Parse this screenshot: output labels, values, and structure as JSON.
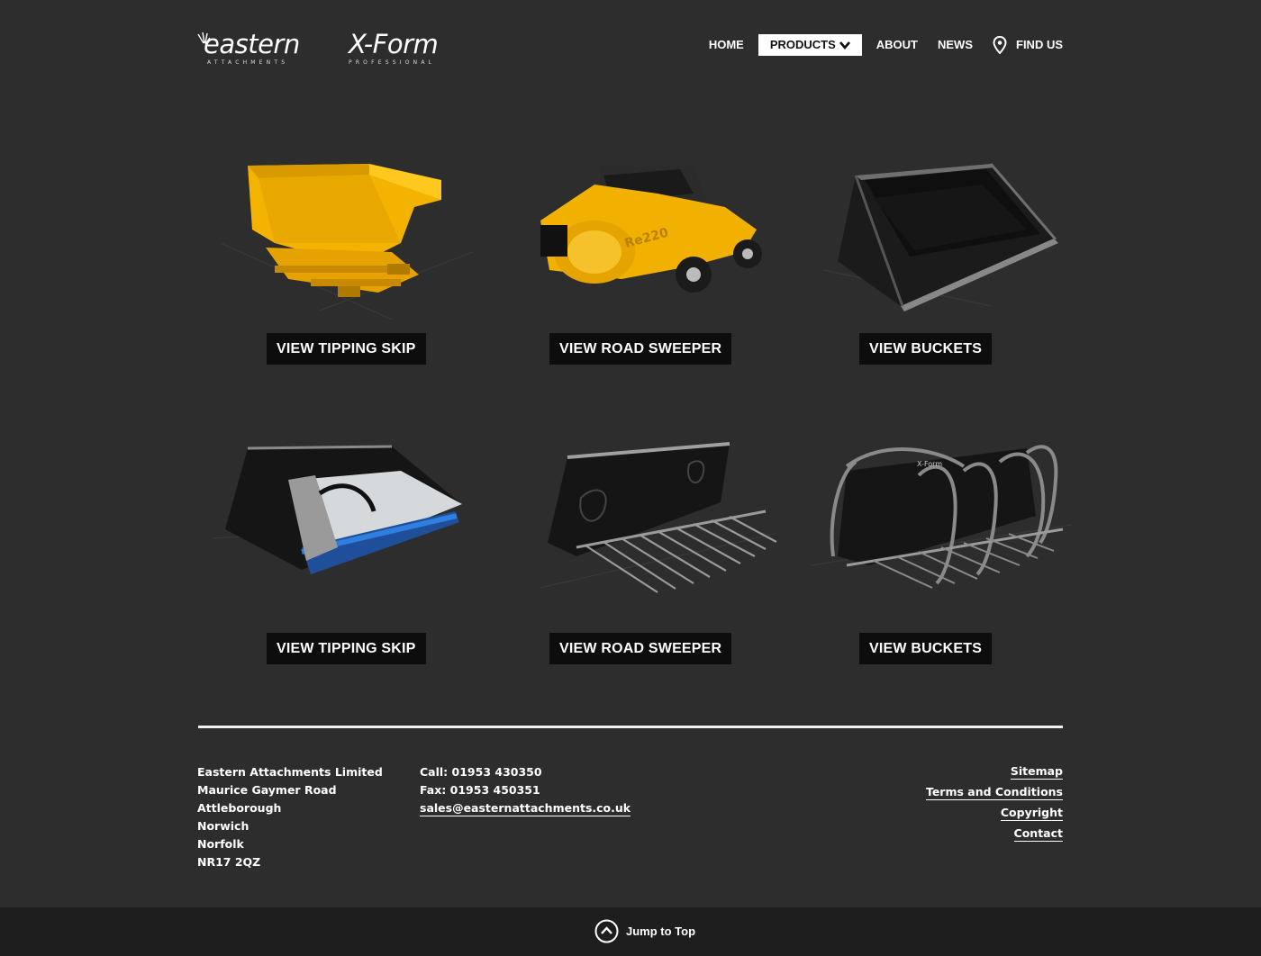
{
  "header": {
    "logo_eastern": "eastern",
    "logo_eastern_sub": "ATTACHMENTS",
    "logo_xform": "X-Form",
    "logo_xform_sub": "PROFESSIONAL",
    "nav": {
      "home": "HOME",
      "products": "PRODUCTS",
      "about": "ABOUT",
      "news": "NEWS",
      "find_us": "FIND US"
    }
  },
  "products": [
    {
      "label": "VIEW TIPPING SKIP",
      "image": "yellow tipping skip"
    },
    {
      "label": "VIEW ROAD SWEEPER",
      "image": "yellow road sweeper"
    },
    {
      "label": "VIEW BUCKETS",
      "image": "black bucket"
    },
    {
      "label": "VIEW TIPPING SKIP",
      "image": "sweeper bucket"
    },
    {
      "label": "VIEW ROAD SWEEPER",
      "image": "muck fork"
    },
    {
      "label": "VIEW BUCKETS",
      "image": "grab fork"
    }
  ],
  "footer": {
    "address": [
      "Eastern Attachments Limited",
      "Maurice Gaymer Road",
      "Attleborough",
      "Norwich",
      "Norfolk",
      "NR17 2QZ"
    ],
    "call": "Call: 01953 430350",
    "fax": "Fax: 01953 450351",
    "email": "sales@easternattachments.co.uk",
    "links": {
      "sitemap": "Sitemap",
      "terms": "Terms and Conditions",
      "copyright": "Copyright",
      "contact": "Contact"
    },
    "jump_to_top": "Jump to Top"
  },
  "colors": {
    "background": "#2d2d2d",
    "button": "#0d0d0d",
    "accent_yellow": "#f2b200",
    "bottom_bar": "#1e1e1e"
  }
}
